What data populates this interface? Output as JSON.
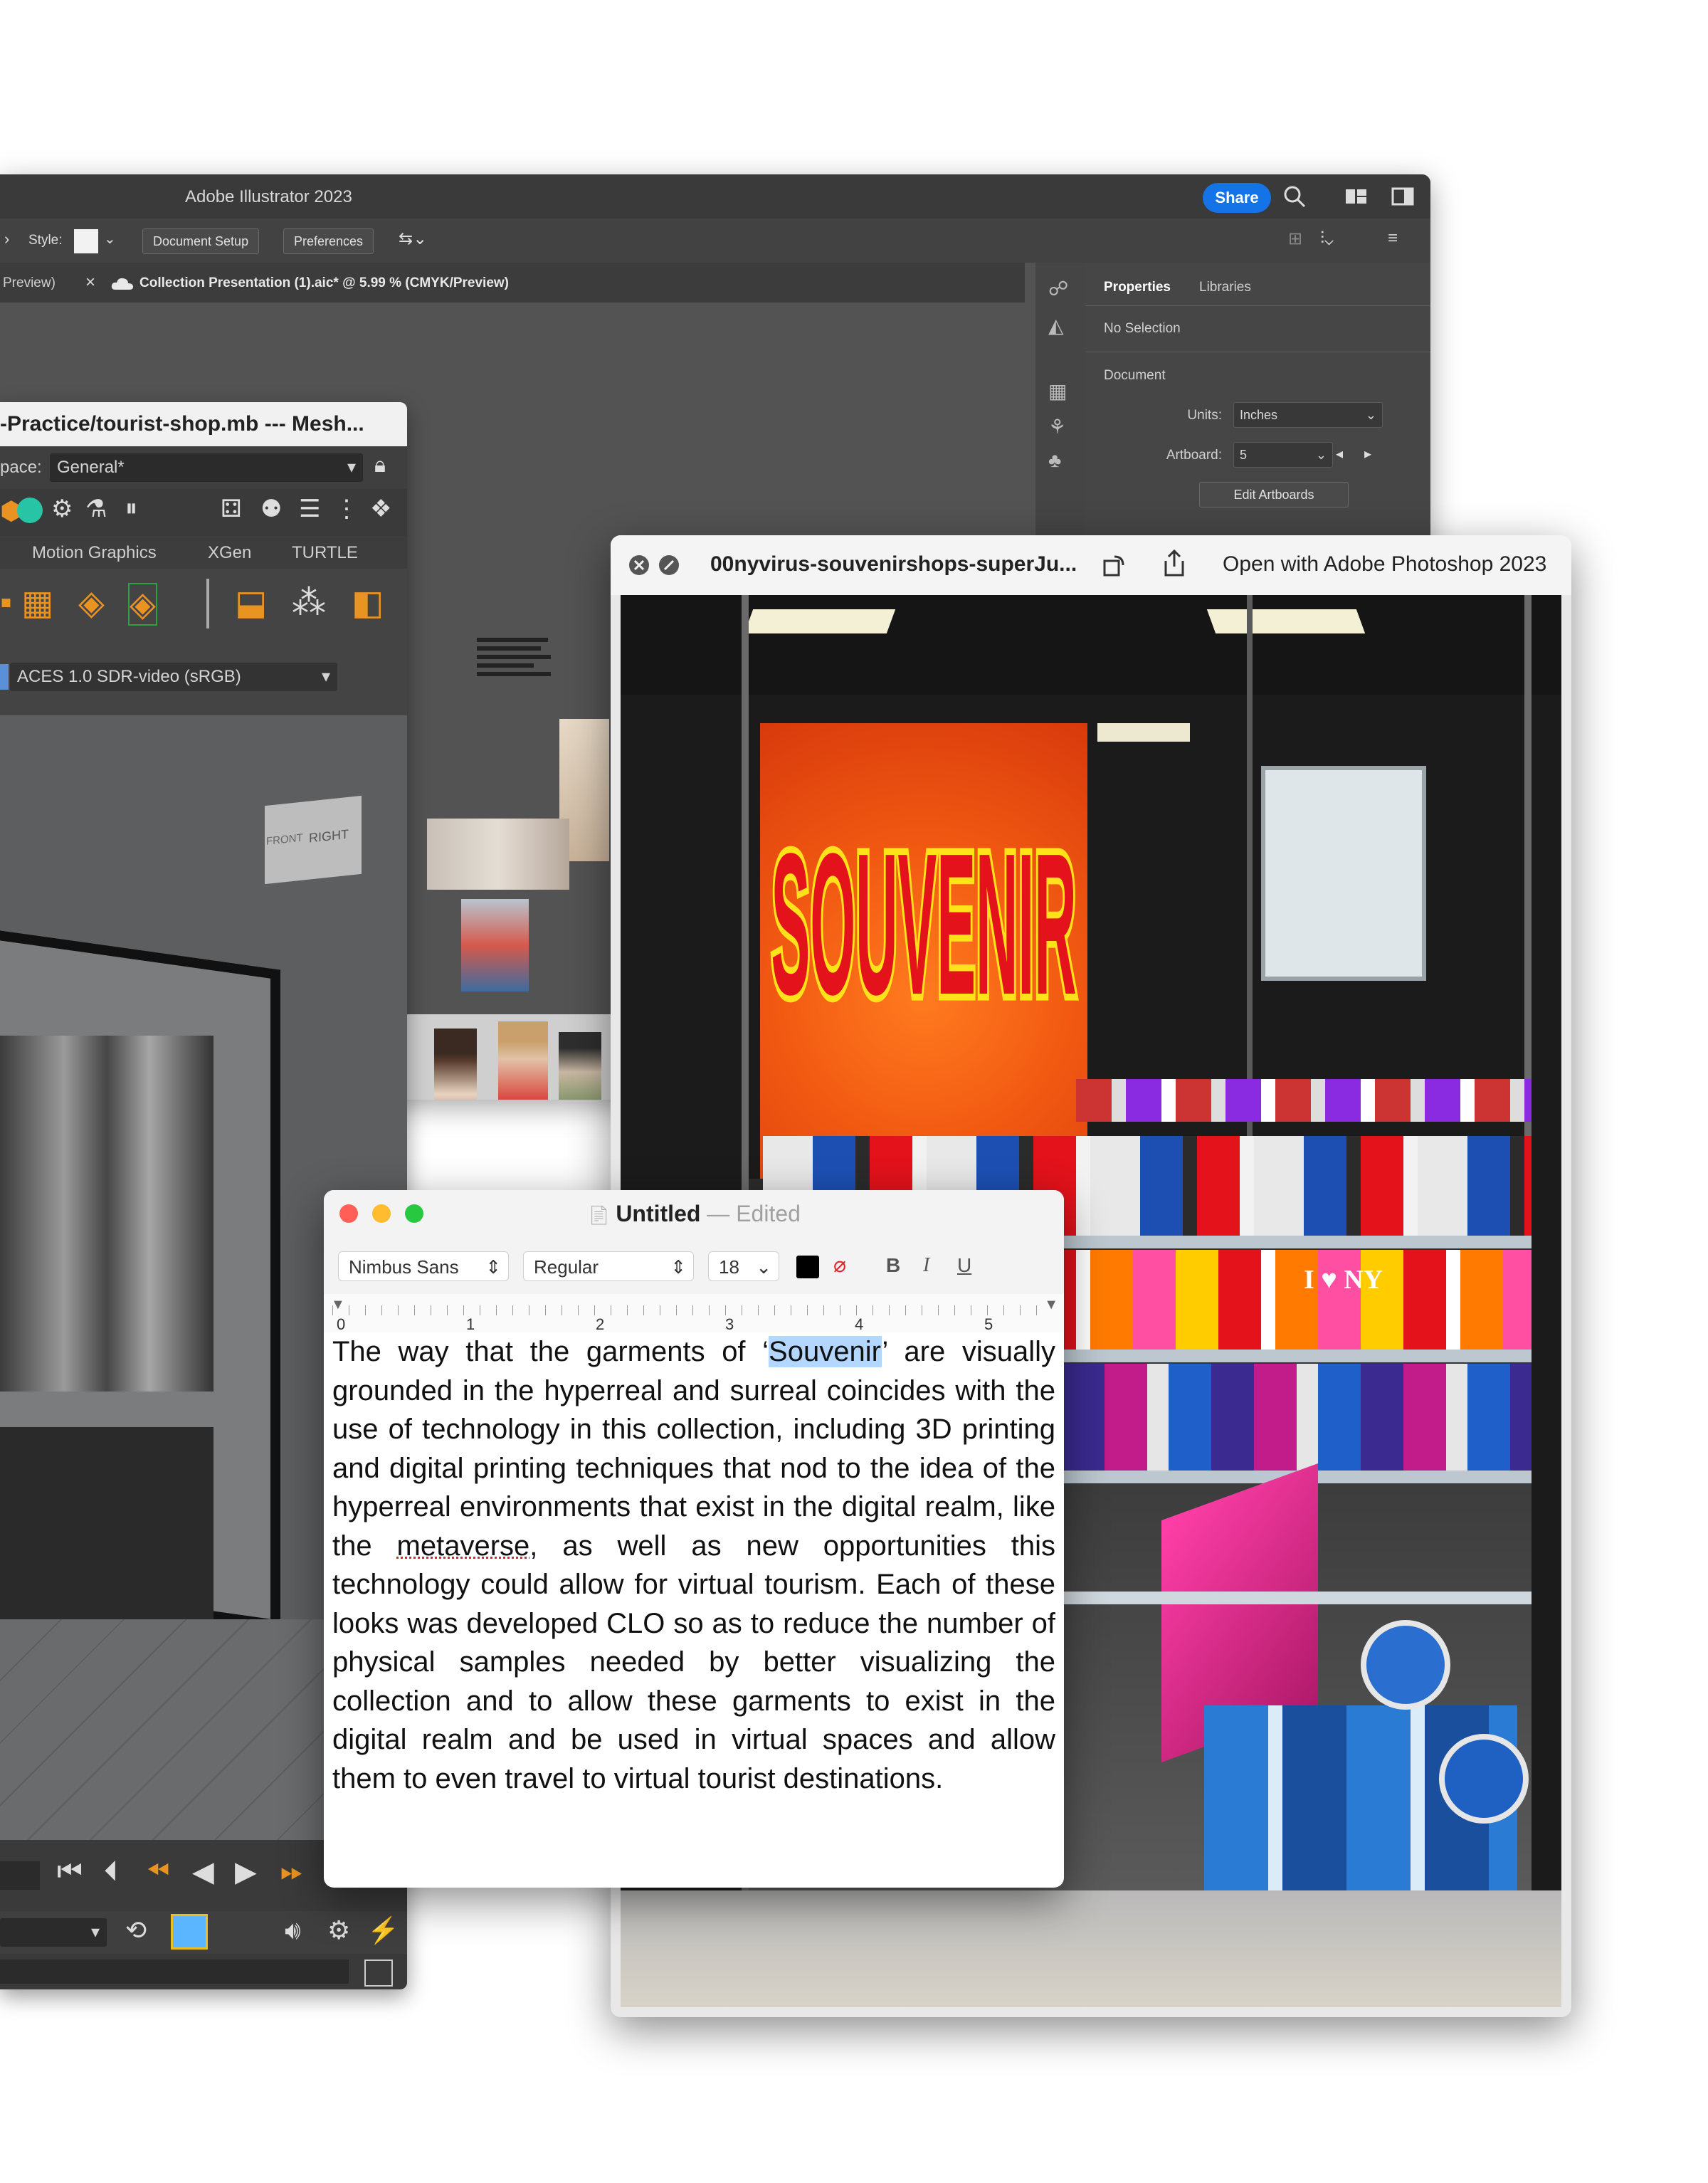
{
  "illustrator": {
    "title": "Adobe Illustrator 2023",
    "share_label": "Share",
    "toolbar": {
      "style_label": "Style:",
      "document_setup": "Document Setup",
      "preferences": "Preferences"
    },
    "tabs": [
      "Preview)",
      "Collection Presentation (1).aic* @ 5.99 % (CMYK/Preview)"
    ],
    "panel_tabs": [
      "Properties",
      "Libraries"
    ],
    "no_selection": "No Selection",
    "section_document": "Document",
    "units_label": "Units:",
    "units_value": "Inches",
    "artboard_label": "Artboard:",
    "artboard_value": "5",
    "edit_artboards": "Edit Artboards"
  },
  "maya": {
    "title": "-Practice/tourist-shop.mb  ---  Mesh...",
    "workspace_label": "pace:",
    "workspace_value": "General*",
    "shelf_tabs": [
      "Motion Graphics",
      "XGen",
      "TURTLE"
    ],
    "color_space": "ACES 1.0 SDR-video (sRGB)",
    "viewcube_front": "FRONT",
    "viewcube_right": "RIGHT"
  },
  "textedit": {
    "title": "Untitled",
    "title_status": "— Edited",
    "font_family": "Nimbus Sans",
    "font_style": "Regular",
    "font_size": "18",
    "bold": "B",
    "italic": "I",
    "underline": "U",
    "ruler_marks": [
      "0",
      "1",
      "2",
      "3",
      "4",
      "5"
    ],
    "body_before": "The way that the garments of ‘",
    "body_highlight": "Souvenir",
    "body_middle": "’ are visually grounded in the hyperreal and surreal coincides with the use of technology in this collection, including 3D printing and digital printing techniques that nod to the idea of the hyperreal environments that exist in the digital realm, like the ",
    "body_spell": "metaverse",
    "body_after": ", as well as new opportunities this technology could allow for virtual tourism. Each of these looks was developed CLO so as to reduce the number of physical samples needed by better visualizing the collection and to allow these garments to exist in the digital realm and be used in virtual spaces and allow them to even travel to virtual tourist destinations."
  },
  "preview": {
    "filename": "00nyvirus-souvenirshops-superJu...",
    "open_with": "Open with Adobe Photoshop 2023",
    "sign_text": "SOUVENIR",
    "mug_text": "I ♥ NY"
  },
  "colors": {
    "accent_blue": "#1473e6",
    "sign_orange": "#f25a12",
    "sign_yellow": "#ffe21a",
    "sign_red": "#e3121b"
  }
}
